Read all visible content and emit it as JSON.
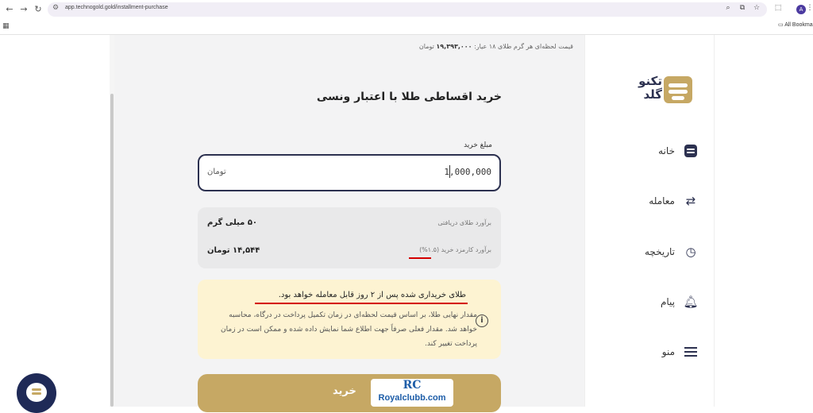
{
  "browser": {
    "url": "app.technogold.gold/installment-purchase",
    "bookmarks_label": "All Bookma",
    "profile_initial": "A"
  },
  "header": {
    "price_prefix": "قیمت لحظه‌ای هر گرم طلای ۱۸ عیار:",
    "price_value": "۱۹,۳۹۳,۰۰۰",
    "price_unit": "تومان"
  },
  "main": {
    "title": "خرید اقساطی طلا با اعتبار ونسی",
    "amount_label": "مبلغ خرید",
    "amount_value": "1,000,000",
    "amount_unit": "تومان",
    "estimate_gold_label": "برآورد طلای دریافتی",
    "estimate_gold_value": "۵۰ میلی گرم",
    "estimate_fee_label": "برآورد کارمزد خرید (۱.۵%)",
    "estimate_fee_value": "۱۴,۵۴۴ تومان",
    "warning_headline": "طلای خریداری شده پس از ۲ روز قابل معامله خواهد بود.",
    "warning_body": "مقدار نهایی طلا، بر اساس قیمت لحظه‌ای در زمان تکمیل پرداخت در درگاه، محاسبه خواهد شد. مقدار فعلی صرفاً جهت اطلاع شما نمایش داده شده و ممکن است در زمان پرداخت تغییر کند.",
    "buy_label": "خرید"
  },
  "watermark": {
    "mark": "RC",
    "text": "Royalclubb.com"
  },
  "sidebar": {
    "logo_line1": "تکنو",
    "logo_line2": "گلد",
    "items": [
      {
        "label": "خانه",
        "icon": "home-icon"
      },
      {
        "label": "معامله",
        "icon": "trade-icon"
      },
      {
        "label": "تاریخچه",
        "icon": "history-icon"
      },
      {
        "label": "پیام",
        "icon": "bell-icon"
      },
      {
        "label": "منو",
        "icon": "menu-icon"
      }
    ]
  },
  "colors": {
    "gold": "#c6a864",
    "navy": "#2c3150",
    "warning_bg": "#fdf3d2",
    "underline_red": "#d40000"
  }
}
